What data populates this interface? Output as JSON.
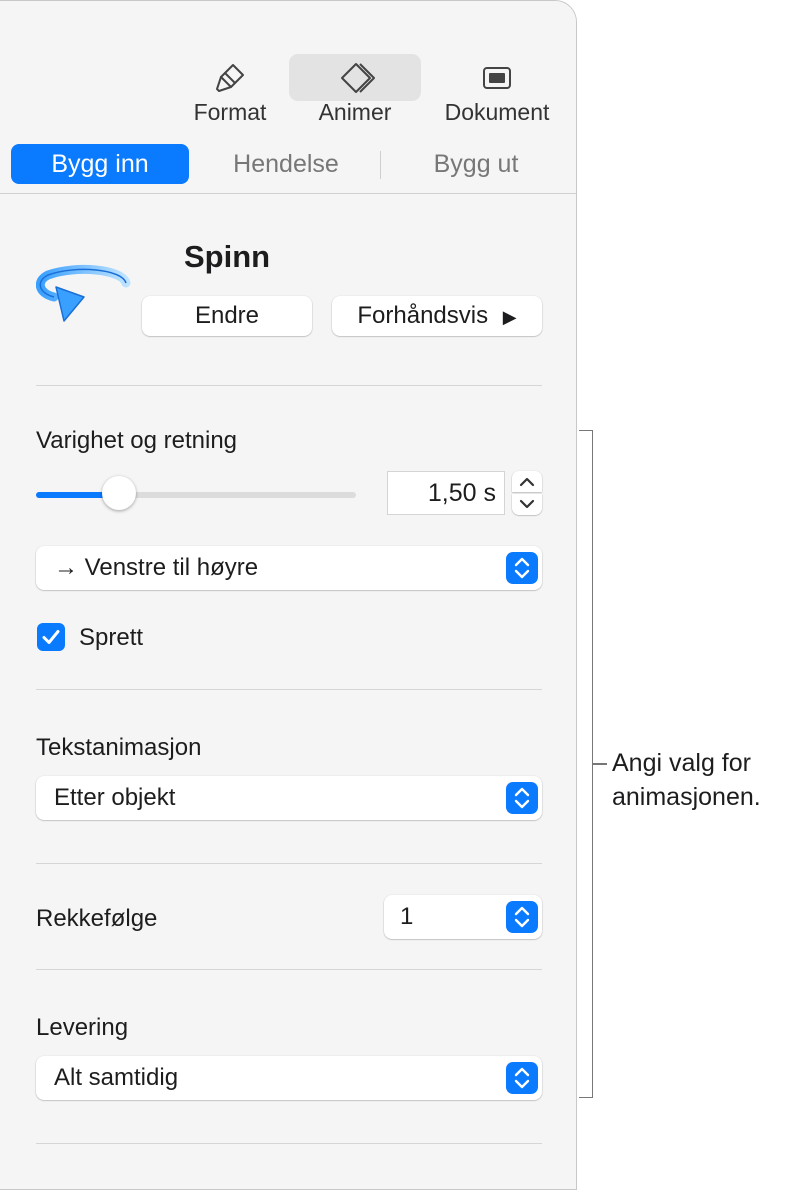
{
  "toolbar": {
    "format_label": "Format",
    "animate_label": "Animer",
    "document_label": "Dokument"
  },
  "tabs": [
    "Bygg inn",
    "Hendelse",
    "Bygg ut"
  ],
  "effect": {
    "name": "Spinn",
    "change_label": "Endre",
    "preview_label": "Forhåndsvis"
  },
  "duration": {
    "label": "Varighet og retning",
    "value": "1,50 s",
    "slider_fraction": 0.26
  },
  "direction": {
    "value": "→  Venstre til høyre"
  },
  "bounce": {
    "label": "Sprett",
    "checked": true
  },
  "text_animation": {
    "label": "Tekstanimasjon",
    "value": "Etter objekt"
  },
  "order": {
    "label": "Rekkefølge",
    "value": "1"
  },
  "delivery": {
    "label": "Levering",
    "value": "Alt samtidig"
  },
  "callout": {
    "line1": "Angi valg for",
    "line2": "animasjonen."
  },
  "colors": {
    "accent": "#0a7aff",
    "panel_bg": "#f5f5f5"
  }
}
